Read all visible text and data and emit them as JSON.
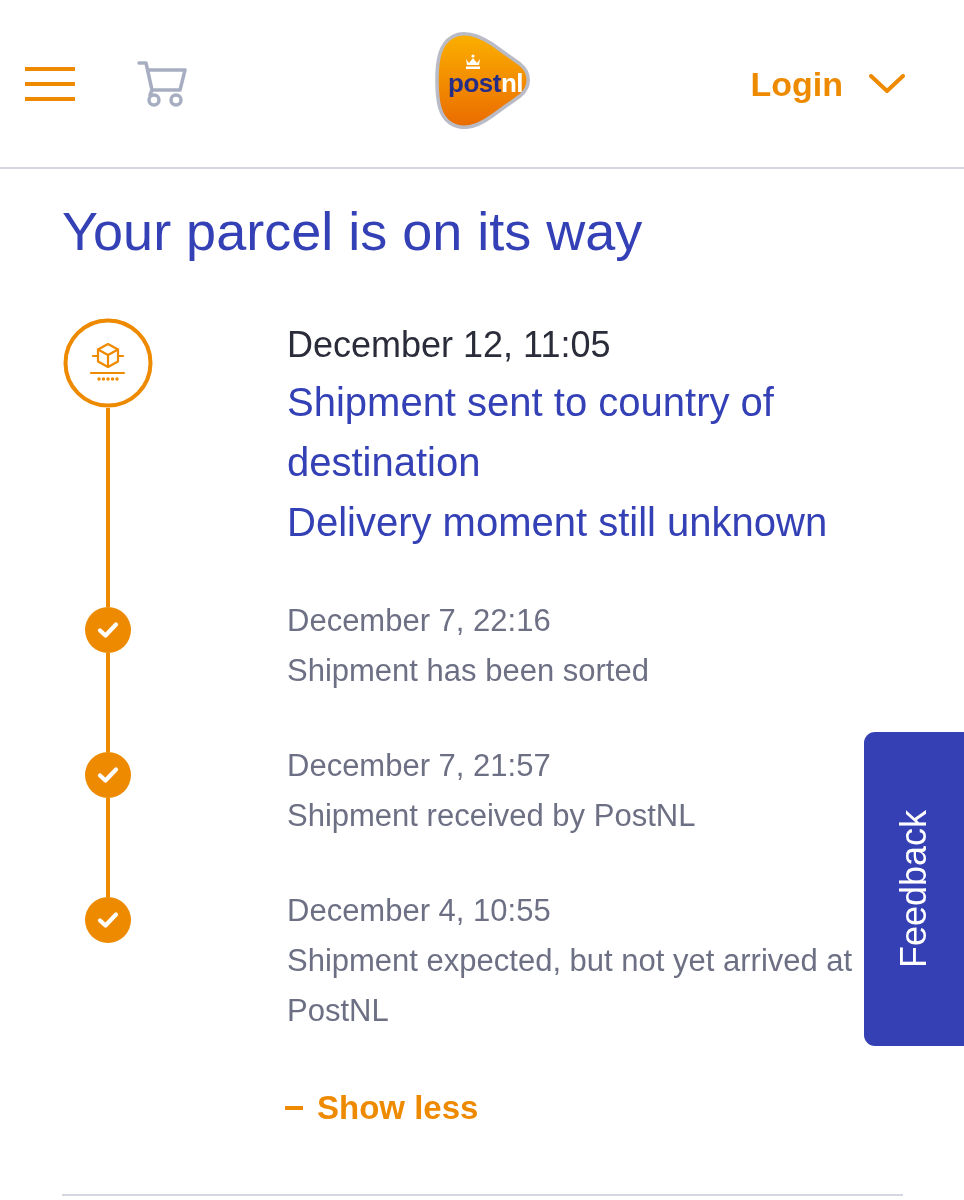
{
  "header": {
    "logo": {
      "wordmark": [
        "post",
        "nl"
      ]
    },
    "login": {
      "label": "Login",
      "expanded": false
    }
  },
  "title": "Your parcel is on its way",
  "events": [
    {
      "kind": "current",
      "date": "December 12, 11:05",
      "lines": [
        "Shipment sent to country of destination",
        "Delivery moment still unknown"
      ]
    },
    {
      "kind": "done",
      "date": "December 7, 22:16",
      "lines": [
        "Shipment has been sorted"
      ]
    },
    {
      "kind": "done",
      "date": "December 7, 21:57",
      "lines": [
        "Shipment received by PostNL"
      ]
    },
    {
      "kind": "done",
      "date": "December 4, 10:55",
      "lines": [
        "Shipment expected, but not yet arrived at PostNL"
      ]
    }
  ],
  "toggle": {
    "label": "Show less",
    "expanded": true
  },
  "feedback": {
    "label": "Feedback"
  }
}
